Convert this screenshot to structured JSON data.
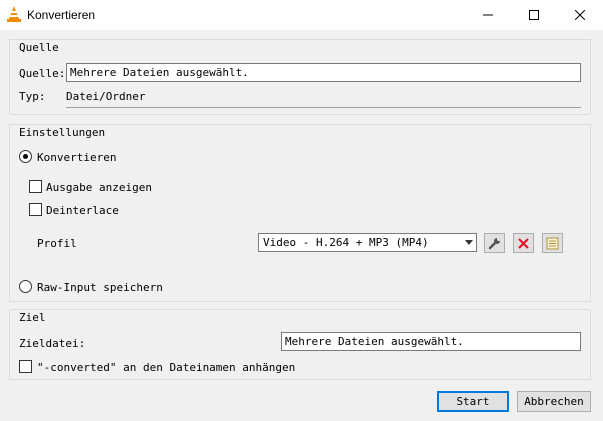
{
  "window": {
    "title": "Konvertieren",
    "icon": "vlc-cone-icon",
    "controls": [
      "minimize-icon",
      "maximize-icon",
      "close-icon"
    ]
  },
  "source": {
    "group_label": "Quelle",
    "source_label": "Quelle:",
    "source_value": "Mehrere Dateien ausgewählt.",
    "type_label": "Typ:",
    "type_value": "Datei/Ordner"
  },
  "settings": {
    "group_label": "Einstellungen",
    "convert_label": "Konvertieren",
    "convert_selected": true,
    "show_output_label": "Ausgabe anzeigen",
    "show_output_checked": false,
    "deinterlace_label": "Deinterlace",
    "deinterlace_checked": false,
    "profile_label": "Profil",
    "profile_value": "Video - H.264 + MP3 (MP4)",
    "profile_buttons": [
      "wrench-icon",
      "delete-x-icon",
      "new-profile-icon"
    ],
    "raw_input_label": "Raw-Input speichern",
    "raw_input_selected": false
  },
  "destination": {
    "group_label": "Ziel",
    "dest_file_label": "Zieldatei:",
    "dest_file_value": "Mehrere Dateien ausgewählt.",
    "append_label": "\"-converted\" an den Dateinamen anhängen",
    "append_checked": false
  },
  "buttons": {
    "start": "Start",
    "cancel": "Abbrechen"
  },
  "colors": {
    "accent": "#0078d7",
    "delete_red": "#e81123",
    "vlc_orange": "#f08c00"
  }
}
